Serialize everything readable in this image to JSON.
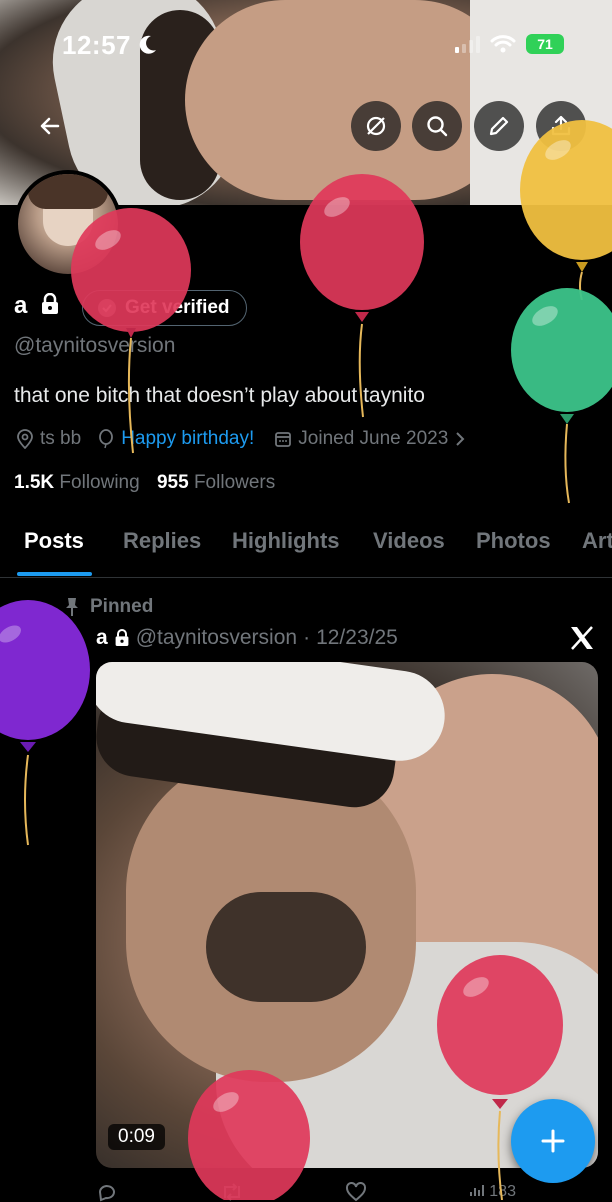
{
  "status_bar": {
    "time": "12:57",
    "battery": "71"
  },
  "profile": {
    "name": "a",
    "verify_label": "Get verified",
    "handle": "@taynitosversion",
    "bio": "that one bitch that doesn’t play about taynito",
    "location": "ts bb",
    "birthday": "Happy birthday!",
    "joined": "Joined June 2023",
    "following_count": "1.5K",
    "following_label": "Following",
    "followers_count": "955",
    "followers_label": "Followers"
  },
  "tabs": [
    "Posts",
    "Replies",
    "Highlights",
    "Videos",
    "Photos",
    "Art"
  ],
  "post": {
    "pinned_label": "Pinned",
    "author": "a",
    "handle": "@taynitosversion",
    "separator": "·",
    "date": "12/23/25",
    "duration": "0:09",
    "views": "183"
  },
  "colors": {
    "accent": "#1d9bf0",
    "balloon_red": "#e0385a",
    "balloon_yellow": "#f0c040",
    "balloon_green": "#3cc48a",
    "balloon_purple": "#8a2be2"
  },
  "icons": [
    "back-arrow-icon",
    "crossed-circle-icon",
    "search-icon",
    "pen-icon",
    "share-icon",
    "lock-icon",
    "location-icon",
    "balloon-icon",
    "calendar-icon",
    "chevron-right-icon",
    "pin-icon",
    "x-logo-icon",
    "plus-icon",
    "reply-icon",
    "repost-icon",
    "like-icon",
    "views-icon"
  ]
}
